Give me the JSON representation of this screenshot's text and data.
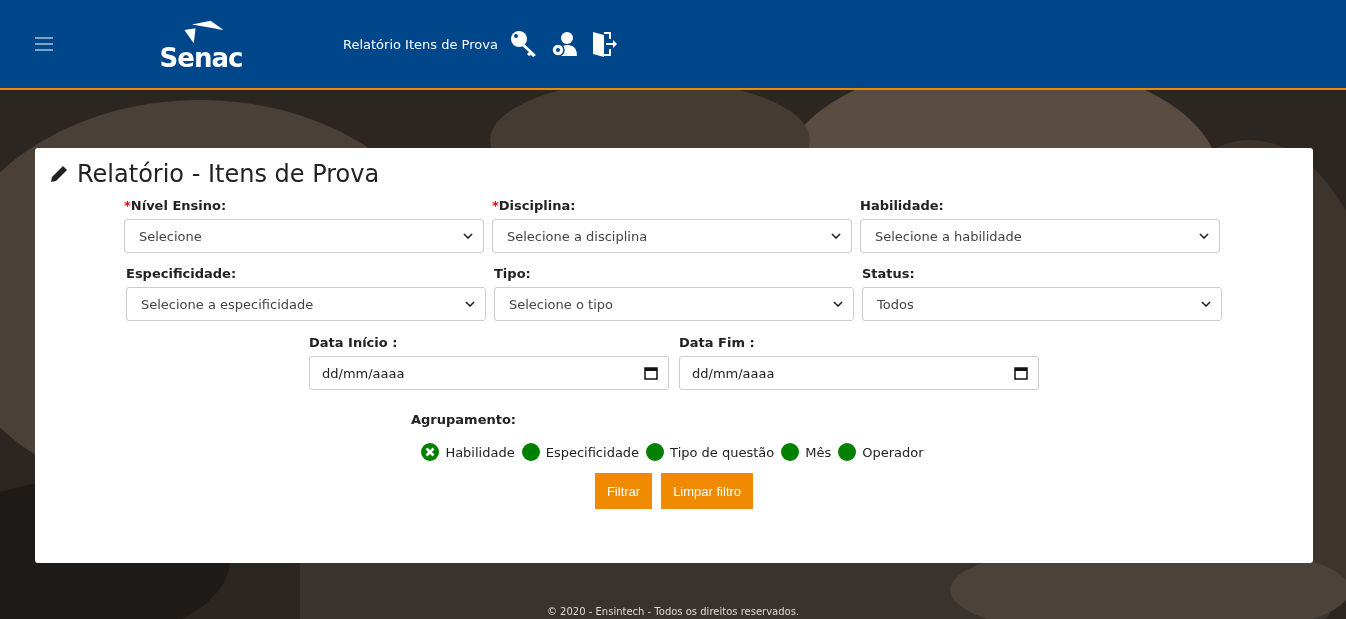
{
  "header": {
    "logo": "Senac",
    "title": "Relatório Itens de Prova"
  },
  "card": {
    "title": "Relatório - Itens de Prova",
    "rows": [
      [
        {
          "required_mark": "*",
          "label": "Nível Ensino:",
          "kind": "select",
          "value": "Selecione"
        },
        {
          "required_mark": "*",
          "label": "Disciplina:",
          "kind": "select",
          "value": "Selecione a disciplina"
        },
        {
          "label": "Habilidade:",
          "kind": "select",
          "value": "Selecione a habilidade"
        }
      ],
      [
        {
          "label": "Especificidade:",
          "kind": "select",
          "value": "Selecione a especificidade"
        },
        {
          "label": "Tipo:",
          "kind": "select",
          "value": "Selecione o tipo"
        },
        {
          "label": "Status:",
          "kind": "select",
          "value": "Todos"
        }
      ],
      [
        {
          "label": "Data Início :",
          "kind": "date",
          "value": "dd/mm/aaaa"
        },
        {
          "label": "Data Fim :",
          "kind": "date",
          "value": "dd/mm/aaaa"
        }
      ]
    ],
    "grouping": {
      "label": "Agrupamento:",
      "options": [
        {
          "label": "Habilidade",
          "selected": true
        },
        {
          "label": "Especificidade",
          "selected": false
        },
        {
          "label": "Tipo de questão",
          "selected": false
        },
        {
          "label": "Mês",
          "selected": false
        },
        {
          "label": "Operador",
          "selected": false
        }
      ]
    },
    "buttons": [
      "Filtrar",
      "Limpar filtro"
    ]
  },
  "footer": "© 2020 - Ensintech - Todos os direitos reservados."
}
